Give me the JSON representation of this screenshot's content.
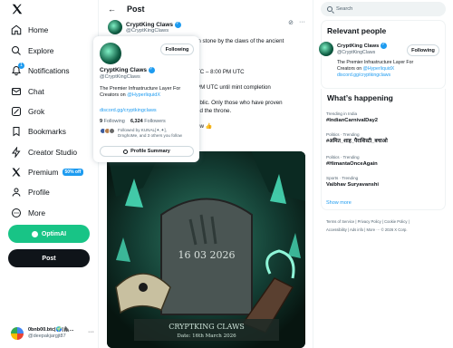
{
  "sidebar": {
    "items": [
      {
        "label": "Home",
        "icon": "home-icon"
      },
      {
        "label": "Explore",
        "icon": "search-icon"
      },
      {
        "label": "Notifications",
        "icon": "bell-icon",
        "badge": "1"
      },
      {
        "label": "Chat",
        "icon": "mail-icon"
      },
      {
        "label": "Grok",
        "icon": "grok-icon"
      },
      {
        "label": "Bookmarks",
        "icon": "bookmark-icon"
      },
      {
        "label": "Creator Studio",
        "icon": "lightning-icon"
      },
      {
        "label": "Premium",
        "icon": "x-premium-icon",
        "badge": "50% off"
      },
      {
        "label": "Profile",
        "icon": "person-icon"
      },
      {
        "label": "More",
        "icon": "more-circle-icon"
      }
    ],
    "optim_label": "OptimAI",
    "post_label": "Post",
    "account": {
      "name": "0bnb00.btc|🌍|🦍...",
      "handle": "@deepakjargjt87"
    }
  },
  "post": {
    "title": "Post",
    "author": {
      "name": "CryptKing Claws",
      "handle": "@CryptKingClaws"
    },
    "text_lines": [
      "in stone by the claws of the ancient",
      "",
      "",
      "",
      "TC – 8:00 PM UTC",
      "",
      "PM UTC until mint completion",
      "",
      "ublic. Only those who have proven",
      "nd the throne.",
      "",
      "ow 👍"
    ],
    "image": {
      "date_text": "16 03 2026",
      "banner_title": "CRYPTKING CLAWS",
      "banner_sub": "Date: 16th March 2026"
    }
  },
  "hover_card": {
    "name": "CryptKing Claws",
    "handle": "@CryptKingClaws",
    "follow_label": "Following",
    "bio_line1": "The Premier Infrastructure Layer For",
    "bio_line2_prefix": "Creators on ",
    "bio_mention": "@HyperliquidX",
    "link": "discord.gg/cryptkingclaws",
    "following_count": "9",
    "following_label": "Following",
    "followers_count": "6,324",
    "followers_label": "Followers",
    "followed_by_line1": "Followed by KUNAL[✦,✦],",
    "followed_by_line2": "DmghoMe, and 3 others you follow",
    "profile_summary_label": "Profile Summary"
  },
  "right": {
    "search_placeholder": "Search",
    "relevant_title": "Relevant people",
    "person": {
      "name": "CryptKing Claws",
      "handle": "@CryptKingClaws",
      "follow_label": "Following",
      "bio_line1": "The Premier Infrastructure Layer For",
      "bio_line2_prefix": "Creators on ",
      "bio_mention": "@HyperliquidX",
      "bio_link": "discord.gg/cryptkingclaws"
    },
    "happening_title": "What’s happening",
    "trends": [
      {
        "context": "Trending in India",
        "tag": "#IndianCarnivalDay2"
      },
      {
        "context": "Politics · Trending",
        "tag": "#अमित_शाह_पैराशिस्टी_बचाओ"
      },
      {
        "context": "Politics · Trending",
        "tag": "#HimantaOnceAgain"
      },
      {
        "context": "Sports · Trending",
        "tag": "Vaibhav Suryavanshi"
      }
    ],
    "show_more": "Show more",
    "footer_line1": "Terms of Service  |  Privacy Policy  |  Cookie Policy  |",
    "footer_line2": "Accessibility  |  Ads info  |  More ···  © 2026 X Corp."
  },
  "colors": {
    "accent": "#1d9bf0",
    "optim": "#18c486",
    "dark": "#0f1419"
  }
}
